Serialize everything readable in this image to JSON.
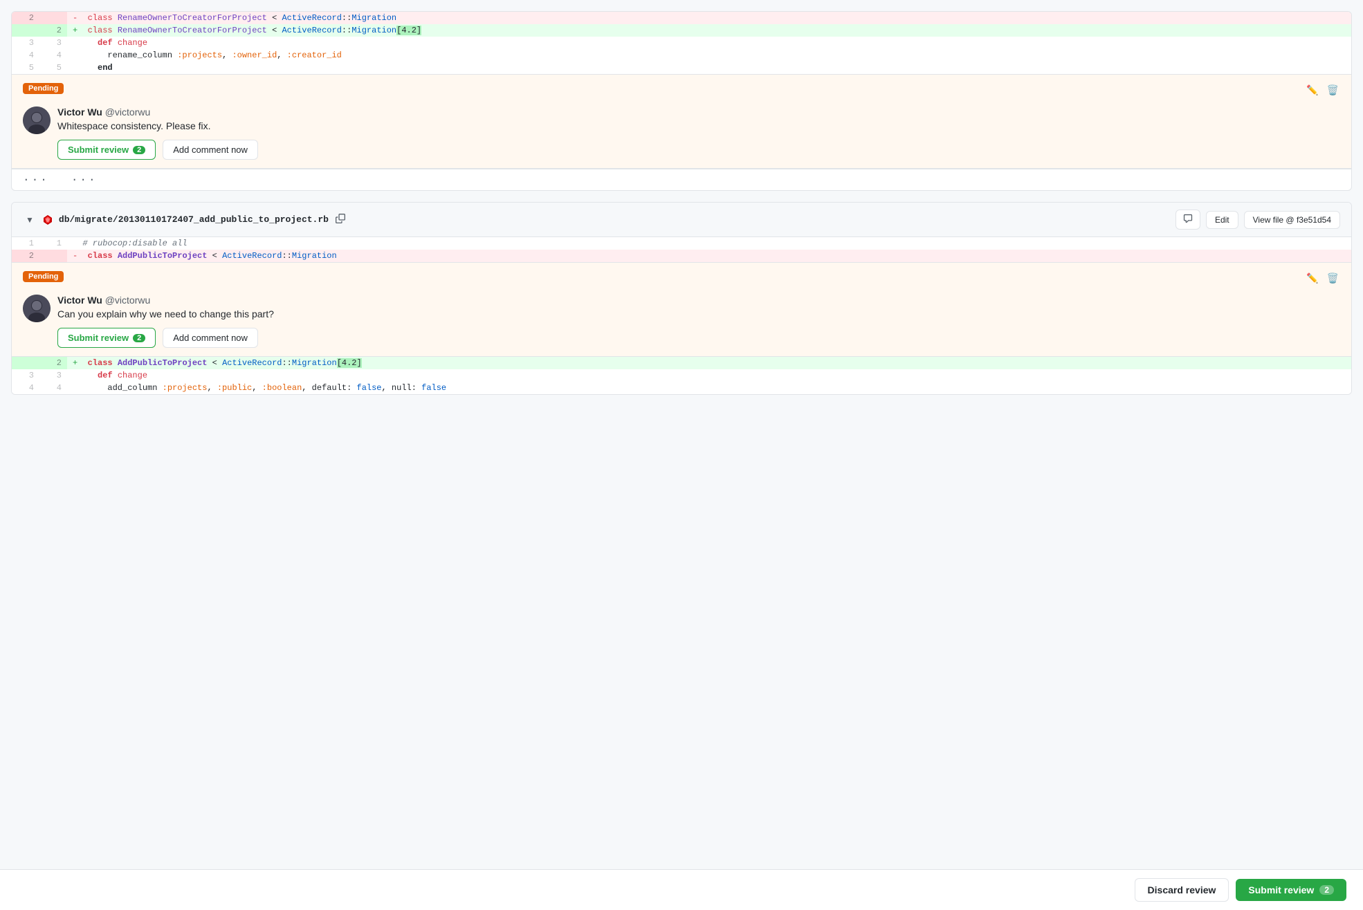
{
  "page": {
    "background": "#f6f8fa"
  },
  "file1": {
    "filename": "db/migrate/20130110172407_add_public_to_project.rb",
    "view_file_label": "View file @ f3e51d54",
    "edit_label": "Edit",
    "collapse_symbol": "▼"
  },
  "bottom_bar": {
    "discard_label": "Discard review",
    "submit_label": "Submit review",
    "count": "2"
  },
  "comment1": {
    "pending_label": "Pending",
    "author": "Victor Wu",
    "handle": "@victorwu",
    "text": "Whitespace consistency. Please fix.",
    "submit_review_label": "Submit review",
    "count": "2",
    "add_comment_label": "Add comment now"
  },
  "comment2": {
    "pending_label": "Pending",
    "author": "Victor Wu",
    "handle": "@victorwu",
    "text": "Can you explain why we need to change this part?",
    "submit_review_label": "Submit review",
    "count": "2",
    "add_comment_label": "Add comment now"
  },
  "code_block1": {
    "lines": [
      {
        "old": "2",
        "new": "",
        "sign": "-",
        "type": "deleted",
        "content": "  class RenameOwnerToCreatorForProject < ActiveRecord::Migration"
      },
      {
        "old": "",
        "new": "2",
        "sign": "+",
        "type": "added",
        "content": "  class RenameOwnerToCreatorForProject < ActiveRecord::Migration[4.2]"
      },
      {
        "old": "3",
        "new": "3",
        "sign": " ",
        "type": "normal",
        "content": "    def change"
      },
      {
        "old": "4",
        "new": "4",
        "sign": " ",
        "type": "normal",
        "content": "      rename_column :projects, :owner_id, :creator_id"
      },
      {
        "old": "5",
        "new": "5",
        "sign": " ",
        "type": "normal",
        "content": "    end"
      }
    ]
  },
  "code_block2": {
    "lines": [
      {
        "old": "1",
        "new": "1",
        "sign": " ",
        "type": "normal",
        "content": "  # rubocop:disable all"
      },
      {
        "old": "2",
        "new": "",
        "sign": "-",
        "type": "deleted",
        "content": "  class AddPublicToProject < ActiveRecord::Migration"
      }
    ]
  },
  "code_block3": {
    "lines": [
      {
        "old": "",
        "new": "2",
        "sign": "+",
        "type": "added",
        "content": "  class AddPublicToProject < ActiveRecord::Migration[4.2]"
      },
      {
        "old": "3",
        "new": "3",
        "sign": " ",
        "type": "normal",
        "content": "    def change"
      },
      {
        "old": "4",
        "new": "4",
        "sign": " ",
        "type": "normal",
        "content": "      add_column :projects, :public, :boolean, default: false, null: false"
      }
    ]
  }
}
